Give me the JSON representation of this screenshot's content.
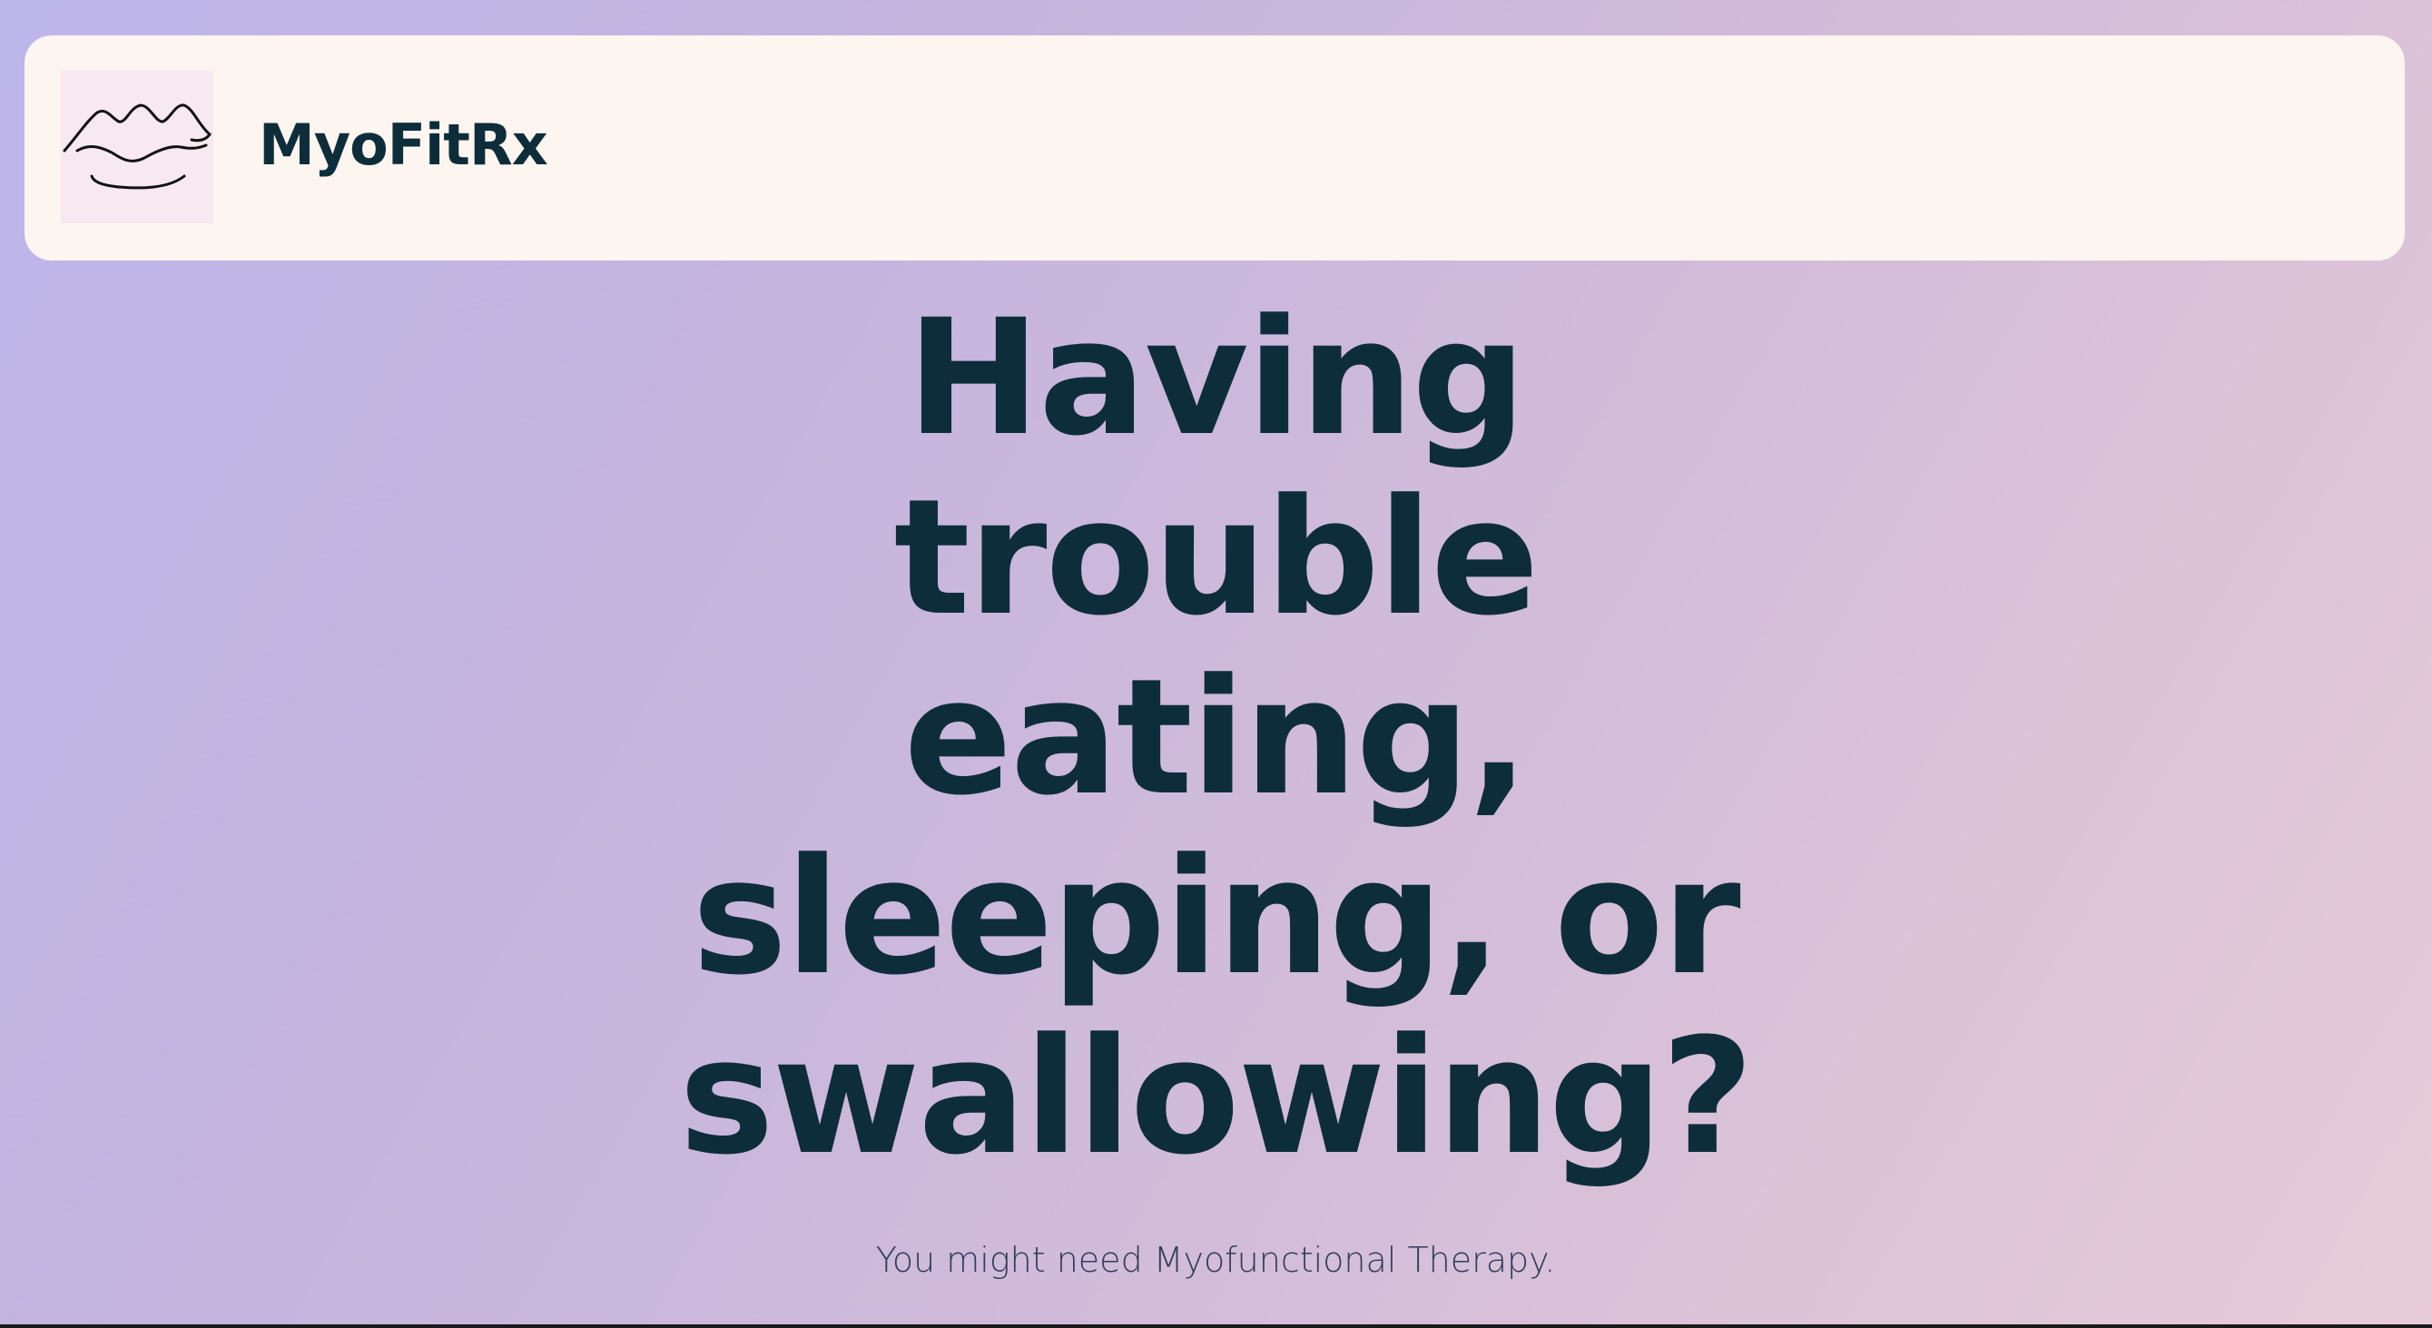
{
  "header": {
    "brand_name": "MyoFitRx",
    "logo_icon": "lips-line-art-icon"
  },
  "hero": {
    "headline": "Having trouble eating, sleeping, or swallowing?",
    "subtext": "You might need Myofunctional Therapy."
  },
  "colors": {
    "text_primary": "#0e2d3b",
    "header_bg": "#fdf5ef",
    "logo_bg": "#f7e8f1",
    "gradient_start": "#bdb6ea",
    "gradient_end": "#e7ccd8"
  }
}
